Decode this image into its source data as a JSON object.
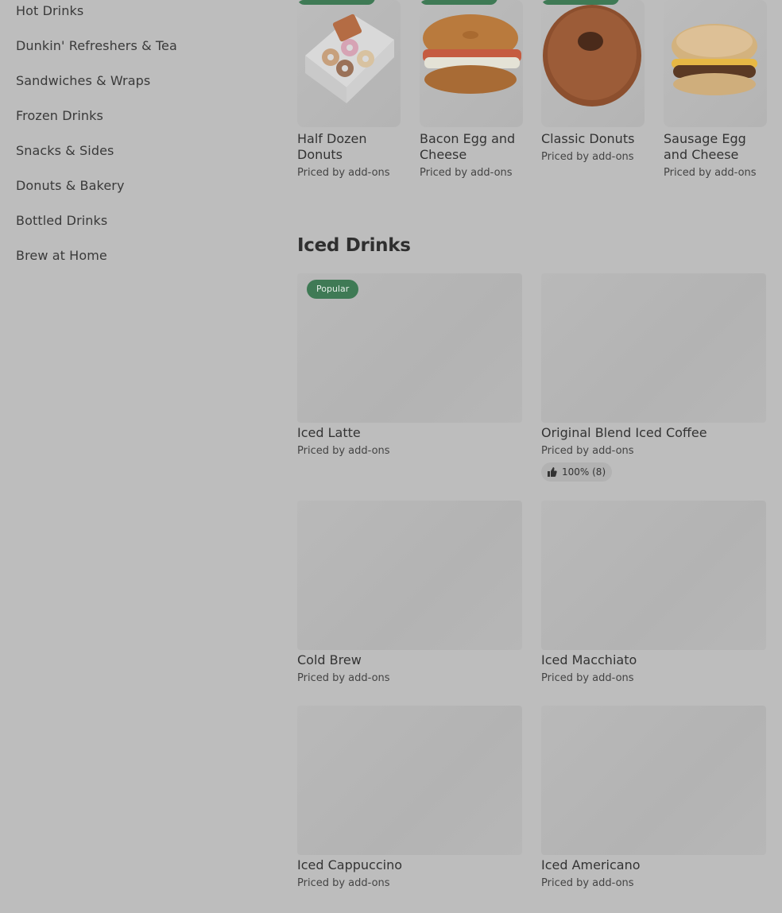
{
  "sidebar": {
    "items": [
      {
        "label": "Hot Drinks"
      },
      {
        "label": "Dunkin' Refreshers & Tea"
      },
      {
        "label": "Sandwiches & Wraps"
      },
      {
        "label": "Frozen Drinks"
      },
      {
        "label": "Snacks & Sides"
      },
      {
        "label": "Donuts & Bakery"
      },
      {
        "label": "Bottled Drinks"
      },
      {
        "label": "Brew at Home"
      }
    ]
  },
  "featured": {
    "items": [
      {
        "name": "Half Dozen Donuts",
        "price": "Priced by add-ons",
        "image_icon": "donut-box-icon"
      },
      {
        "name": "Bacon Egg and Cheese",
        "price": "Priced by add-ons",
        "image_icon": "bagel-sandwich-icon"
      },
      {
        "name": "Classic Donuts",
        "price": "Priced by add-ons",
        "image_icon": "donut-icon"
      },
      {
        "name": "Sausage Egg and Cheese",
        "price": "Priced by add-ons",
        "image_icon": "muffin-sandwich-icon"
      }
    ]
  },
  "iced_drinks": {
    "title": "Iced Drinks",
    "items": [
      {
        "name": "Iced Latte",
        "price": "Priced by add-ons",
        "badge": "Popular"
      },
      {
        "name": "Original Blend Iced Coffee",
        "price": "Priced by add-ons",
        "rating": "100% (8)"
      },
      {
        "name": "Cold Brew",
        "price": "Priced by add-ons"
      },
      {
        "name": "Iced Macchiato",
        "price": "Priced by add-ons"
      },
      {
        "name": "Iced Cappuccino",
        "price": "Priced by add-ons"
      },
      {
        "name": "Iced Americano",
        "price": "Priced by add-ons"
      }
    ]
  },
  "colors": {
    "overlay_background": "#bdbdbd",
    "badge_green": "#3f7a55"
  }
}
